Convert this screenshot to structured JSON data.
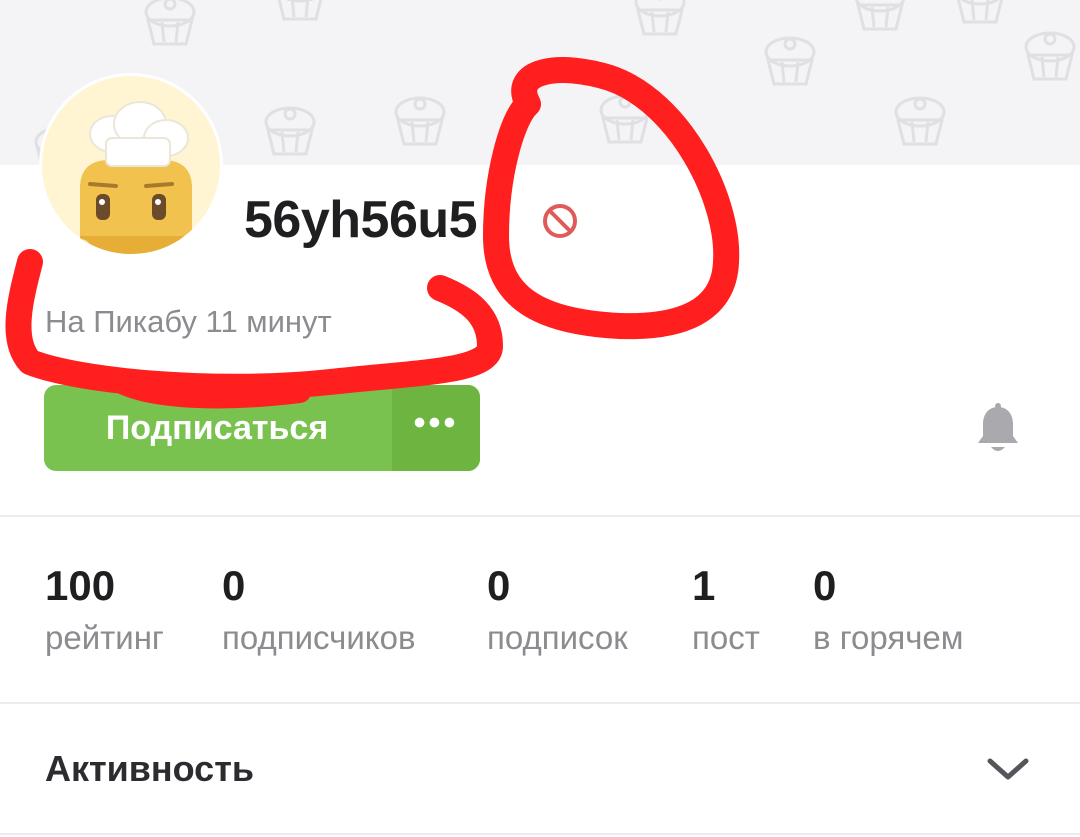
{
  "profile": {
    "username": "56yh56u5",
    "member_since": "На Пикабу 11 минут",
    "subscribe_label": "Подписаться",
    "more_label": "•••"
  },
  "stats": [
    {
      "value": "100",
      "label": "рейтинг"
    },
    {
      "value": "0",
      "label": "подписчиков"
    },
    {
      "value": "0",
      "label": "подписок"
    },
    {
      "value": "1",
      "label": "пост"
    },
    {
      "value": "0",
      "label": "в горячем"
    }
  ],
  "activity": {
    "title": "Активность"
  },
  "icons": {
    "ban": "ban-icon",
    "bell": "bell-icon",
    "chevron": "chevron-down-icon"
  },
  "colors": {
    "accent_green": "#7ac250",
    "accent_green_dark": "#6db441",
    "ban_red": "#e05a5a",
    "annotation_red": "#ff1f1f",
    "text_primary": "#1f1f22",
    "text_secondary": "#8b8b90"
  }
}
